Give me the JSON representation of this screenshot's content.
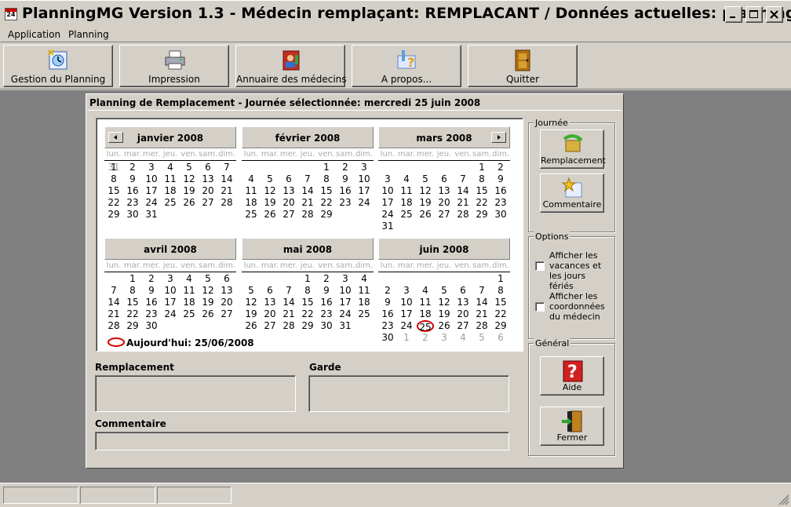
{
  "window": {
    "title": "PlanningMG Version 1.3 - Médecin remplaçant: REMPLACANT / Données actuelles: planning.dat",
    "icon_text": "24"
  },
  "menu": [
    {
      "label": "Application"
    },
    {
      "label": "Planning"
    }
  ],
  "toolbar": [
    {
      "label": "Gestion du Planning",
      "icon": "planning-icon"
    },
    {
      "label": "Impression",
      "icon": "printer-icon"
    },
    {
      "label": "Annuaire des médecins",
      "icon": "address-book-icon"
    },
    {
      "label": "A propos...",
      "icon": "help-about-icon"
    },
    {
      "label": "Quitter",
      "icon": "door-exit-icon"
    }
  ],
  "child": {
    "title": "Planning de Remplacement - Journée sélectionnée: mercredi 25 juin 2008",
    "weekdays": [
      "lun.",
      "mar.",
      "mer.",
      "jeu.",
      "ven.",
      "sam.",
      "dim."
    ],
    "months": [
      {
        "name": "janvier 2008",
        "offset": 0,
        "days": 31,
        "prev_tail": [
          "31"
        ],
        "next_tail": []
      },
      {
        "name": "février 2008",
        "offset": 4,
        "days": 29,
        "prev_tail": [],
        "next_tail": []
      },
      {
        "name": "mars 2008",
        "offset": 5,
        "days": 31,
        "prev_tail": [],
        "next_tail": []
      },
      {
        "name": "avril 2008",
        "offset": 1,
        "days": 30,
        "prev_tail": [],
        "next_tail": []
      },
      {
        "name": "mai 2008",
        "offset": 3,
        "days": 31,
        "prev_tail": [],
        "next_tail": []
      },
      {
        "name": "juin 2008",
        "offset": 6,
        "days": 30,
        "prev_tail": [],
        "next_tail": [
          "1",
          "2",
          "3",
          "4",
          "5",
          "6"
        ]
      }
    ],
    "selected": {
      "month_index": 5,
      "day": "25"
    },
    "today_text": "Aujourd'hui: 25/06/2008",
    "journee": {
      "label": "Journée",
      "remplacement_label": "Remplacement",
      "commentaire_label": "Commentaire"
    },
    "options": {
      "label": "Options",
      "vacances_label": "Afficher les vacances et les jours fériés",
      "coordonnees_label": "Afficher les coordonnées du médecin",
      "vacances_checked": false,
      "coordonnees_checked": false
    },
    "general": {
      "label": "Général",
      "aide_label": "Aide",
      "fermer_label": "Fermer"
    },
    "fields": {
      "remplacement_label": "Remplacement",
      "garde_label": "Garde",
      "commentaire_label": "Commentaire",
      "remplacement_value": "",
      "garde_value": "",
      "commentaire_value": ""
    }
  },
  "statusbar": {
    "panels": [
      "",
      "",
      ""
    ]
  }
}
